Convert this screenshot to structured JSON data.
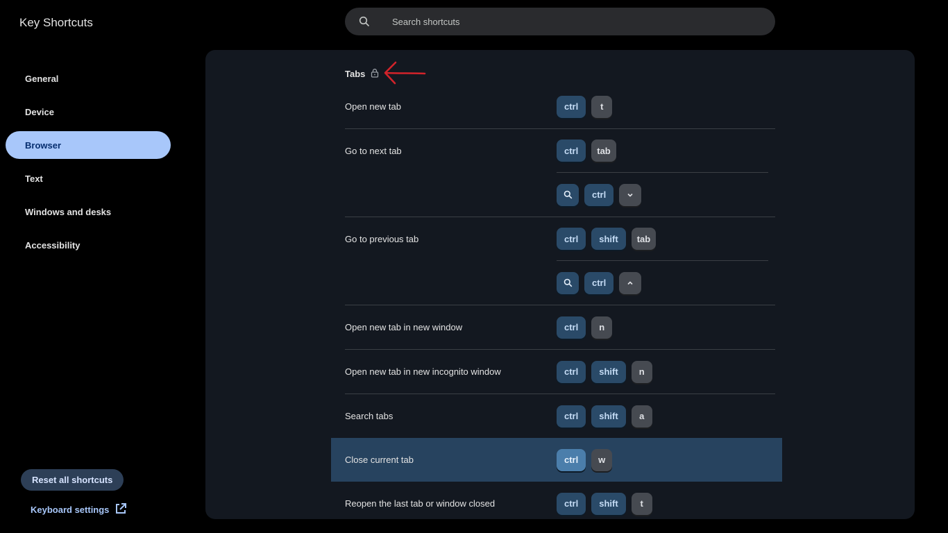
{
  "app": {
    "title": "Key Shortcuts"
  },
  "search": {
    "placeholder": "Search shortcuts"
  },
  "sidebar": {
    "items": [
      {
        "label": "General",
        "active": false
      },
      {
        "label": "Device",
        "active": false
      },
      {
        "label": "Browser",
        "active": true
      },
      {
        "label": "Text",
        "active": false
      },
      {
        "label": "Windows and desks",
        "active": false
      },
      {
        "label": "Accessibility",
        "active": false
      }
    ],
    "reset_label": "Reset all shortcuts",
    "keyboard_settings_label": "Keyboard settings"
  },
  "section": {
    "title": "Tabs",
    "locked_icon": "lock-icon",
    "annotation": "red-arrow"
  },
  "shortcuts": [
    {
      "label": "Open new tab",
      "accelerators": [
        [
          "ctrl",
          "t"
        ]
      ]
    },
    {
      "label": "Go to next tab",
      "accelerators": [
        [
          "ctrl",
          "tab"
        ],
        [
          "search-icon",
          "ctrl",
          "down-icon"
        ]
      ]
    },
    {
      "label": "Go to previous tab",
      "accelerators": [
        [
          "ctrl",
          "shift",
          "tab"
        ],
        [
          "search-icon",
          "ctrl",
          "up-icon"
        ]
      ]
    },
    {
      "label": "Open new tab in new window",
      "accelerators": [
        [
          "ctrl",
          "n"
        ]
      ]
    },
    {
      "label": "Open new tab in new incognito window",
      "accelerators": [
        [
          "ctrl",
          "shift",
          "n"
        ]
      ]
    },
    {
      "label": "Search tabs",
      "accelerators": [
        [
          "ctrl",
          "shift",
          "a"
        ]
      ]
    },
    {
      "label": "Close current tab",
      "accelerators": [
        [
          "ctrl",
          "w"
        ]
      ],
      "selected": true
    },
    {
      "label": "Reopen the last tab or window closed",
      "accelerators": [
        [
          "ctrl",
          "shift",
          "t"
        ]
      ]
    }
  ],
  "colors": {
    "accent": "#a8c7fa",
    "panel": "#131820",
    "selected_row": "#27435f",
    "annotation_red": "#d2232a"
  }
}
